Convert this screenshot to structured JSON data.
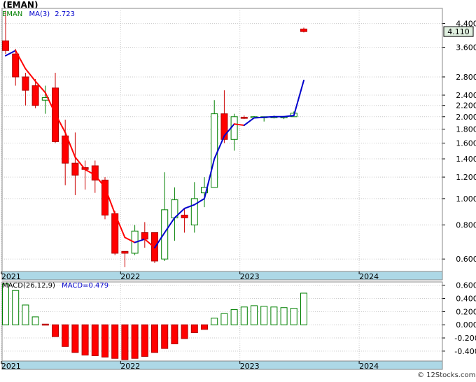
{
  "header": {
    "ticker": "(EMAN)"
  },
  "legend": {
    "series_name": "EMAN",
    "ma_label": "MA(3)",
    "ma_value": "2.723",
    "macd_label": "MACD(26,12,9)",
    "macd_name": "MACD",
    "macd_value": "0.479"
  },
  "badge": {
    "last_price": "4.110"
  },
  "watermark": "© 12Stocks.com",
  "colors": {
    "up": "#008000",
    "down": "#ff0000",
    "ma_up": "#0000cc",
    "ma_down": "#ff0000",
    "axis_band": "#add8e6",
    "badge_bg": "#e0f0e0"
  },
  "chart_data": [
    {
      "type": "candlestick",
      "scale": "log",
      "ylim": [
        0.54,
        5.0
      ],
      "yticks": [
        "0.600",
        "0.800",
        "1.000",
        "1.200",
        "1.400",
        "1.600",
        "1.800",
        "2.000",
        "2.200",
        "2.400",
        "2.800",
        "3.600",
        "4.400"
      ],
      "ytick_values": [
        0.6,
        0.8,
        1.0,
        1.2,
        1.4,
        1.6,
        1.8,
        2.0,
        2.2,
        2.4,
        2.8,
        3.6,
        4.4
      ],
      "year_labels": [
        "2021",
        "2022",
        "2023",
        "2024"
      ],
      "year_index": [
        0,
        12,
        24,
        36
      ],
      "candles": [
        {
          "o": 3.8,
          "h": 4.9,
          "l": 3.4,
          "c": 3.5
        },
        {
          "o": 3.4,
          "h": 3.55,
          "l": 2.6,
          "c": 2.8
        },
        {
          "o": 2.8,
          "h": 2.9,
          "l": 2.2,
          "c": 2.5
        },
        {
          "o": 2.6,
          "h": 2.75,
          "l": 2.15,
          "c": 2.2
        },
        {
          "o": 2.3,
          "h": 2.6,
          "l": 2.05,
          "c": 2.35
        },
        {
          "o": 2.55,
          "h": 2.9,
          "l": 1.6,
          "c": 1.62
        },
        {
          "o": 1.7,
          "h": 1.95,
          "l": 1.12,
          "c": 1.35
        },
        {
          "o": 1.35,
          "h": 1.75,
          "l": 1.03,
          "c": 1.22
        },
        {
          "o": 1.3,
          "h": 1.38,
          "l": 1.08,
          "c": 1.28
        },
        {
          "o": 1.32,
          "h": 1.38,
          "l": 1.05,
          "c": 1.17
        },
        {
          "o": 1.17,
          "h": 1.2,
          "l": 0.84,
          "c": 0.87
        },
        {
          "o": 0.88,
          "h": 0.9,
          "l": 0.62,
          "c": 0.63
        },
        {
          "o": 0.64,
          "h": 0.64,
          "l": 0.56,
          "c": 0.63
        },
        {
          "o": 0.63,
          "h": 0.8,
          "l": 0.62,
          "c": 0.76
        },
        {
          "o": 0.75,
          "h": 0.82,
          "l": 0.66,
          "c": 0.71
        },
        {
          "o": 0.75,
          "h": 0.75,
          "l": 0.58,
          "c": 0.59
        },
        {
          "o": 0.6,
          "h": 1.25,
          "l": 0.59,
          "c": 0.91
        },
        {
          "o": 0.85,
          "h": 1.1,
          "l": 0.7,
          "c": 0.99
        },
        {
          "o": 0.87,
          "h": 0.92,
          "l": 0.75,
          "c": 0.85
        },
        {
          "o": 0.8,
          "h": 1.15,
          "l": 0.75,
          "c": 1.0
        },
        {
          "o": 1.05,
          "h": 1.2,
          "l": 0.93,
          "c": 1.1
        },
        {
          "o": 1.1,
          "h": 2.3,
          "l": 1.1,
          "c": 2.05
        },
        {
          "o": 2.05,
          "h": 2.5,
          "l": 1.6,
          "c": 1.65
        },
        {
          "o": 1.65,
          "h": 2.05,
          "l": 1.5,
          "c": 2.0
        },
        {
          "o": 1.99,
          "h": 2.02,
          "l": 1.96,
          "c": 1.98
        },
        {
          "o": 1.98,
          "h": 2.01,
          "l": 1.97,
          "c": 2.0
        },
        {
          "o": 2.0,
          "h": 2.0,
          "l": 1.92,
          "c": 2.0
        },
        {
          "o": 1.99,
          "h": 2.02,
          "l": 1.97,
          "c": 2.0
        },
        {
          "o": 1.98,
          "h": 2.01,
          "l": 1.96,
          "c": 2.0
        },
        {
          "o": 2.0,
          "h": 2.09,
          "l": 2.0,
          "c": 2.06
        },
        {
          "o": 4.2,
          "h": 4.25,
          "l": 4.08,
          "c": 4.11
        }
      ],
      "ma": [
        3.35,
        3.5,
        3.0,
        2.7,
        2.45,
        2.05,
        1.75,
        1.42,
        1.28,
        1.22,
        1.1,
        0.88,
        0.72,
        0.69,
        0.71,
        0.66,
        0.75,
        0.85,
        0.92,
        0.95,
        1.0,
        1.4,
        1.7,
        1.88,
        1.86,
        1.98,
        1.99,
        2.0,
        2.0,
        2.02,
        2.72
      ]
    },
    {
      "type": "bar",
      "name": "MACD(26,12,9)",
      "ylim": [
        -0.55,
        0.65
      ],
      "yticks": [
        "0.600",
        "0.400",
        "0.200",
        "0.000",
        "-0.200",
        "-0.400"
      ],
      "ytick_values": [
        0.6,
        0.4,
        0.2,
        0.0,
        -0.2,
        -0.4
      ],
      "values": [
        0.62,
        0.52,
        0.3,
        0.12,
        0.01,
        -0.18,
        -0.33,
        -0.42,
        -0.46,
        -0.47,
        -0.49,
        -0.51,
        -0.53,
        -0.51,
        -0.48,
        -0.42,
        -0.36,
        -0.29,
        -0.21,
        -0.12,
        -0.07,
        0.1,
        0.17,
        0.23,
        0.27,
        0.29,
        0.28,
        0.27,
        0.26,
        0.25,
        0.48
      ],
      "signs": [
        "up",
        "up",
        "up",
        "up",
        "down",
        "down",
        "down",
        "down",
        "down",
        "down",
        "down",
        "down",
        "down",
        "down",
        "down",
        "down",
        "down",
        "down",
        "down",
        "down",
        "down",
        "up",
        "up",
        "up",
        "up",
        "up",
        "up",
        "up",
        "up",
        "up",
        "up"
      ]
    }
  ]
}
